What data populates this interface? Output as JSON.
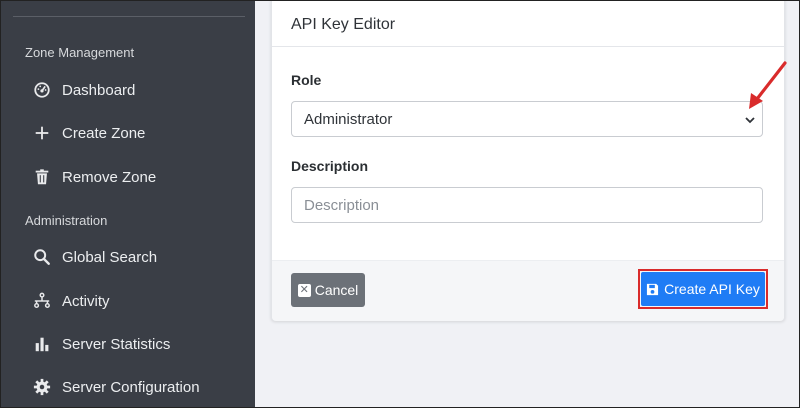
{
  "sidebar": {
    "sections": [
      {
        "title": "Zone Management"
      },
      {
        "title": "Administration"
      }
    ],
    "items": [
      {
        "label": "Dashboard",
        "icon": "dashboard-icon"
      },
      {
        "label": "Create Zone",
        "icon": "plus-icon"
      },
      {
        "label": "Remove Zone",
        "icon": "trash-icon"
      },
      {
        "label": "Global Search",
        "icon": "search-icon"
      },
      {
        "label": "Activity",
        "icon": "activity-icon"
      },
      {
        "label": "Server Statistics",
        "icon": "bar-chart-icon"
      },
      {
        "label": "Server Configuration",
        "icon": "gear-icon"
      }
    ]
  },
  "card": {
    "title": "API Key Editor",
    "role_label": "Role",
    "role_value": "Administrator",
    "description_label": "Description",
    "description_placeholder": "Description",
    "cancel_label": "Cancel",
    "create_label": "Create API Key"
  },
  "colors": {
    "sidebar_bg": "#3a3e46",
    "primary": "#1f7cf5",
    "secondary": "#6c7178",
    "annotation": "#d92b2b"
  }
}
